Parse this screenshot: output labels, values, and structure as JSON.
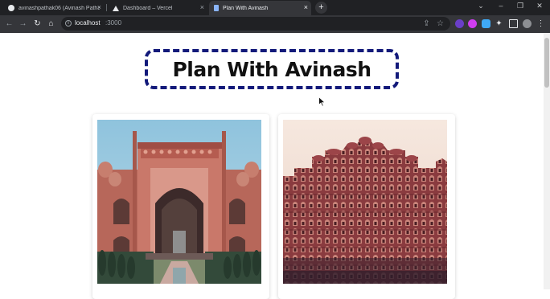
{
  "browser": {
    "tabs": [
      {
        "label": "avinashpathak06 (Avinash Pathak)",
        "icon": "github-icon",
        "active": false
      },
      {
        "label": "Dashboard – Vercel",
        "icon": "vercel-icon",
        "active": false
      },
      {
        "label": "Plan With Avinash",
        "icon": "page-icon",
        "active": true
      }
    ],
    "url_host": "localhost",
    "url_port": ":3000"
  },
  "page": {
    "title": "Plan With Avinash",
    "tour_cards": [
      {
        "image": "taj-mahal-gate-photo"
      },
      {
        "image": "hawa-mahal-photo"
      }
    ]
  },
  "colors": {
    "title_border": "#131a7a",
    "chrome_dark": "#202124",
    "chrome_mid": "#35363a"
  }
}
